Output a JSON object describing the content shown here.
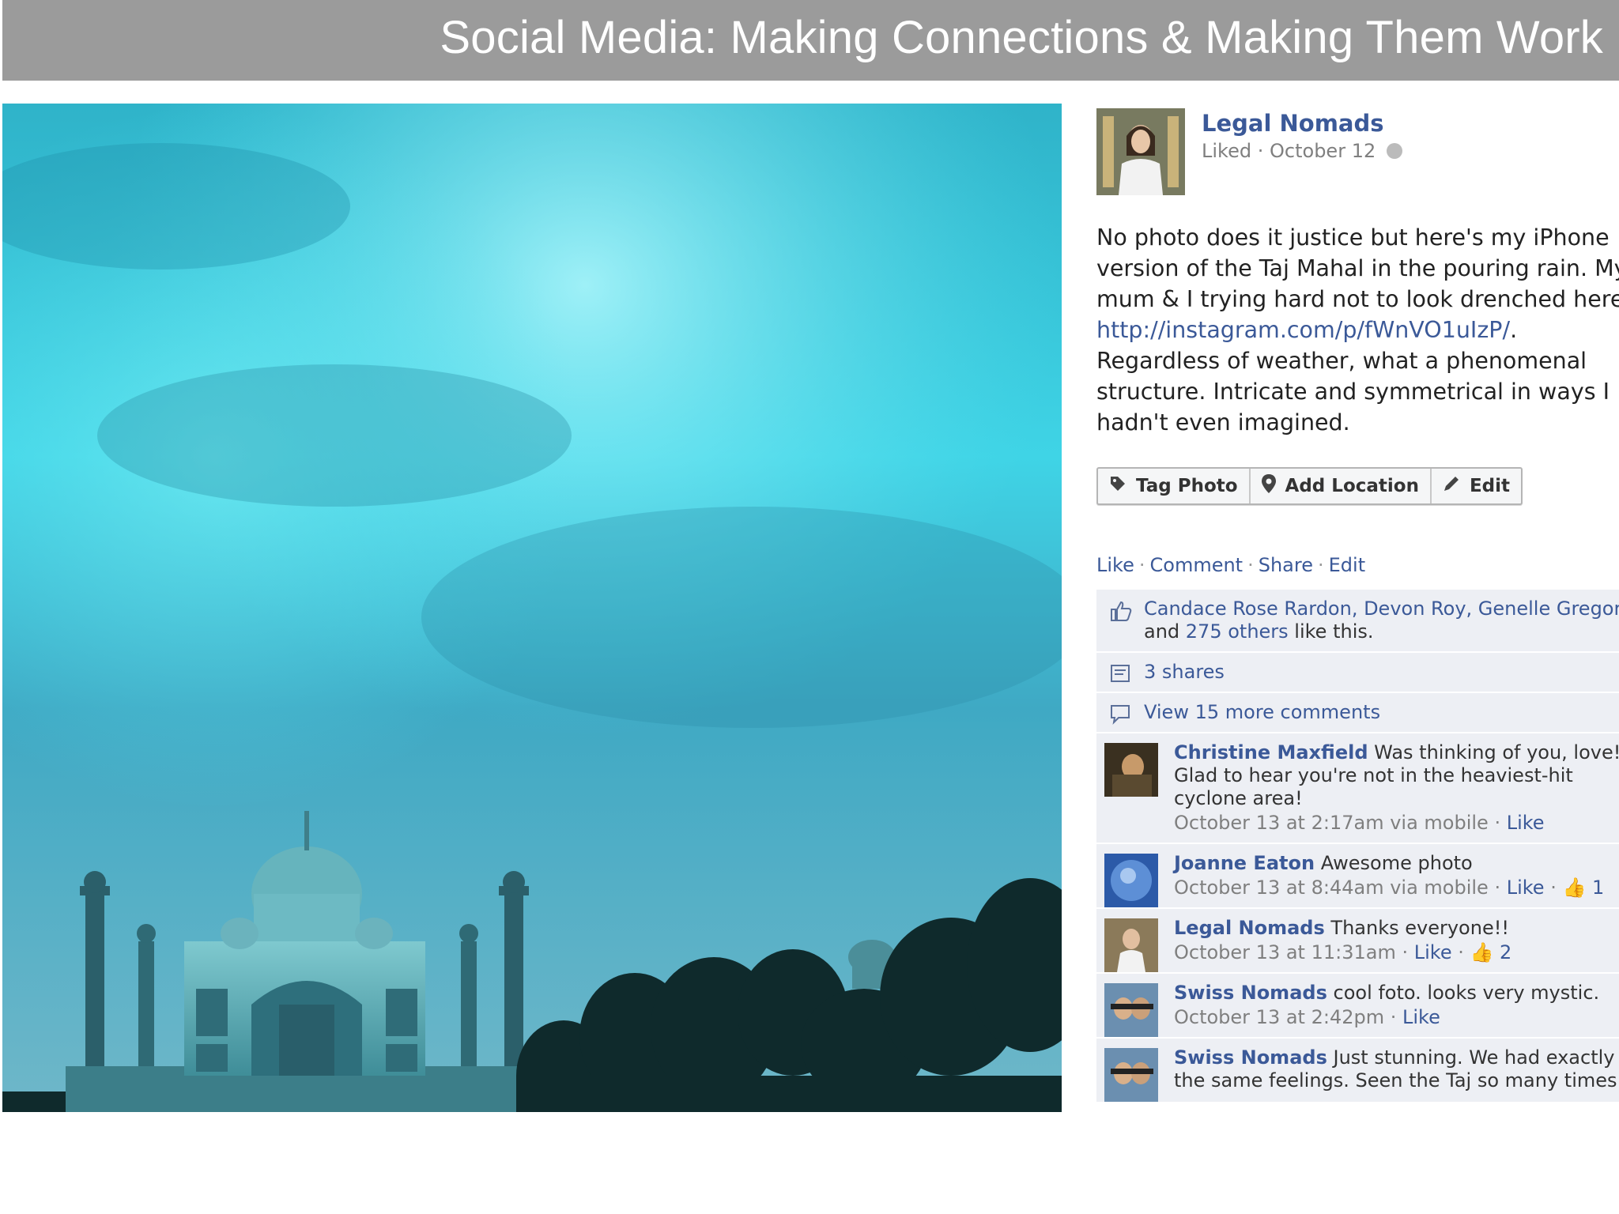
{
  "slide": {
    "title": "Social Media: Making Connections & Making Them Work"
  },
  "photo": {
    "subject": "Taj Mahal under a stormy cyan sky"
  },
  "post": {
    "page_name": "Legal Nomads",
    "liked_label": "Liked",
    "meta_separator": "·",
    "date": "October 12",
    "text_line1": "No photo does it justice but here's my iPhone",
    "text_line2": "version of the Taj Mahal in the pouring rain. My",
    "text_line3": "mum & I trying hard not to look drenched here:",
    "link": "http://instagram.com/p/fWnVO1uIzP/",
    "link_suffix": ".",
    "text_line5": "Regardless of weather, what a phenomenal",
    "text_line6": "structure. Intricate and symmetrical in ways I",
    "text_line7": "hadn't even imagined."
  },
  "photo_actions": {
    "tag_photo": "Tag Photo",
    "add_location": "Add Location",
    "edit": "Edit"
  },
  "post_actions": {
    "like": "Like",
    "comment": "Comment",
    "share": "Share",
    "edit": "Edit",
    "sep": "·"
  },
  "likes": {
    "names": "Candace Rose Rardon, Devon Roy, Genelle Gregori",
    "and_label": "and ",
    "others": "275 others",
    "suffix": " like this."
  },
  "shares": {
    "label": "3 shares"
  },
  "view_more": {
    "label": "View 15 more comments"
  },
  "comments": [
    {
      "author": "Christine Maxfield",
      "text_a": "Was thinking of you, love!",
      "text_b": "Glad to hear you're not in the heaviest-hit",
      "text_c": "cyclone area!",
      "time": "October 13 at 2:17am via mobile",
      "like": "Like"
    },
    {
      "author": "Joanne Eaton",
      "text_a": "Awesome photo",
      "time": "October 13 at 8:44am via mobile",
      "like": "Like",
      "thumbs": "1"
    },
    {
      "author": "Legal Nomads",
      "text_a": "Thanks everyone!!",
      "time": "October 13 at 11:31am",
      "like": "Like",
      "thumbs": "2"
    },
    {
      "author": "Swiss Nomads",
      "text_a": "cool foto. looks very mystic.",
      "time": "October 13 at 2:42pm",
      "like": "Like"
    },
    {
      "author": "Swiss Nomads",
      "text_a": "Just stunning. We had exactly",
      "text_b": "the same feelings. Seen the Taj so many times"
    }
  ],
  "colors": {
    "header_bg": "#9b9b9b",
    "fb_blue": "#3b5998",
    "ufi_bg": "#edeff4"
  }
}
